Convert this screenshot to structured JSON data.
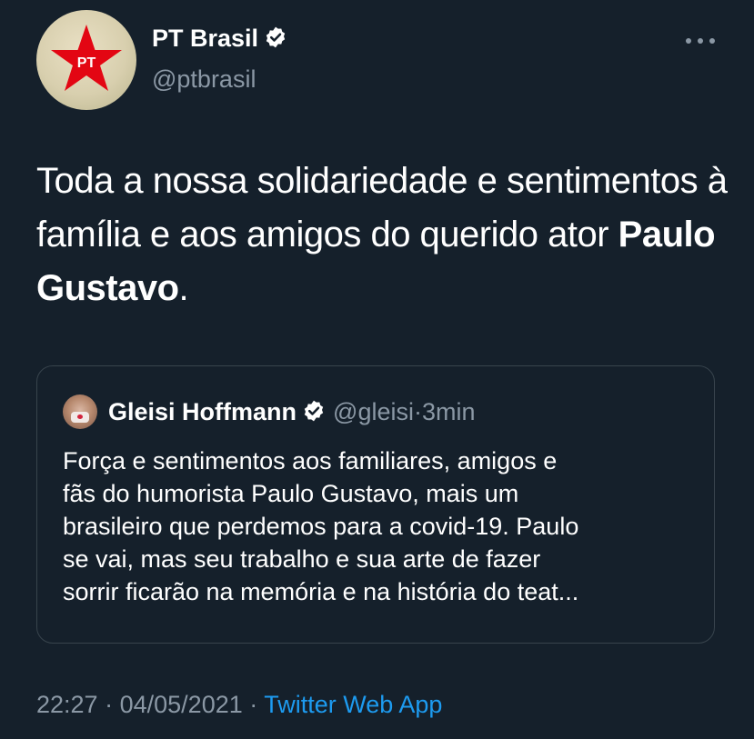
{
  "author": {
    "name": "PT Brasil",
    "handle": "@ptbrasil",
    "avatar_text": "PT",
    "avatar_star_color": "#e30613",
    "verified_icon": "verified-badge-icon"
  },
  "more_icon": "more-horizontal-icon",
  "tweet": {
    "text_plain": "Toda a nossa solidariedade e sentimentos à família e aos amigos do querido ator ",
    "text_bold": "Paulo Gustavo",
    "text_end": "."
  },
  "quoted": {
    "name": "Gleisi Hoffmann",
    "handle": "@gleisi",
    "separator": "·",
    "time": "3min",
    "lines": [
      "Força e sentimentos aos familiares, amigos e",
      "fãs do humorista Paulo Gustavo, mais um",
      "brasileiro que perdemos para a covid-19. Paulo",
      "se vai, mas seu trabalho e sua arte de fazer",
      "sorrir ficarão na memória e na história do teat..."
    ]
  },
  "footer": {
    "time": "22:27",
    "separator1": "·",
    "date": "04/05/2021",
    "separator2": "·",
    "source": "Twitter Web App"
  },
  "colors": {
    "background": "#15202b",
    "secondary_text": "#8b98a5",
    "link": "#1d9bf0",
    "border": "#38444d"
  }
}
